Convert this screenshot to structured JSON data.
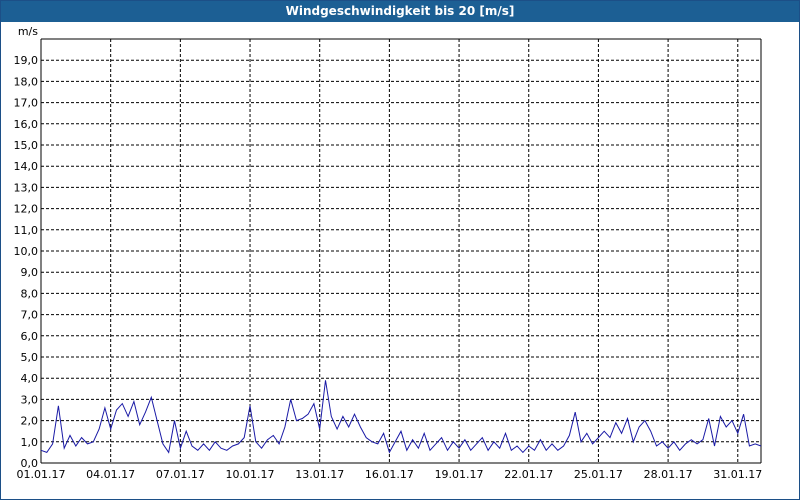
{
  "window": {
    "title": "Windgeschwindigkeit bis 20 [m/s]"
  },
  "colors": {
    "titlebar": "#1c5f94",
    "line": "#1a1aa6",
    "grid": "#000000"
  },
  "chart_data": {
    "type": "line",
    "title": "Windgeschwindigkeit bis 20 [m/s]",
    "ylabel": "m/s",
    "xlabel": "",
    "ylim": [
      0,
      20
    ],
    "xlim": [
      "2017-01-01",
      "2017-02-01"
    ],
    "grid": true,
    "y_ticks": [
      "0,0",
      "1,0",
      "2,0",
      "3,0",
      "4,0",
      "5,0",
      "6,0",
      "7,0",
      "8,0",
      "9,0",
      "10,0",
      "11,0",
      "12,0",
      "13,0",
      "14,0",
      "15,0",
      "16,0",
      "17,0",
      "18,0",
      "19,0"
    ],
    "x_ticks": [
      {
        "date": "2017-01-01",
        "label": "01.01.17"
      },
      {
        "date": "2017-01-04",
        "label": "04.01.17"
      },
      {
        "date": "2017-01-07",
        "label": "07.01.17"
      },
      {
        "date": "2017-01-10",
        "label": "10.01.17"
      },
      {
        "date": "2017-01-13",
        "label": "13.01.17"
      },
      {
        "date": "2017-01-16",
        "label": "16.01.17"
      },
      {
        "date": "2017-01-19",
        "label": "19.01.17"
      },
      {
        "date": "2017-01-22",
        "label": "22.01.17"
      },
      {
        "date": "2017-01-25",
        "label": "25.01.17"
      },
      {
        "date": "2017-01-28",
        "label": "28.01.17"
      },
      {
        "date": "2017-01-31",
        "label": "31.01.17"
      }
    ],
    "series": [
      {
        "values": [
          [
            "2017-01-01 00:00",
            0.6
          ],
          [
            "2017-01-01 06:00",
            0.5
          ],
          [
            "2017-01-01 12:00",
            0.9
          ],
          [
            "2017-01-01 18:00",
            2.7
          ],
          [
            "2017-01-02 00:00",
            0.7
          ],
          [
            "2017-01-02 06:00",
            1.3
          ],
          [
            "2017-01-02 12:00",
            0.8
          ],
          [
            "2017-01-02 18:00",
            1.2
          ],
          [
            "2017-01-03 00:00",
            0.9
          ],
          [
            "2017-01-03 06:00",
            1.0
          ],
          [
            "2017-01-03 12:00",
            1.6
          ],
          [
            "2017-01-03 18:00",
            2.6
          ],
          [
            "2017-01-04 00:00",
            1.6
          ],
          [
            "2017-01-04 06:00",
            2.5
          ],
          [
            "2017-01-04 12:00",
            2.8
          ],
          [
            "2017-01-04 18:00",
            2.2
          ],
          [
            "2017-01-05 00:00",
            2.9
          ],
          [
            "2017-01-05 06:00",
            1.8
          ],
          [
            "2017-01-05 12:00",
            2.4
          ],
          [
            "2017-01-05 18:00",
            3.1
          ],
          [
            "2017-01-06 00:00",
            2.0
          ],
          [
            "2017-01-06 06:00",
            0.9
          ],
          [
            "2017-01-06 12:00",
            0.5
          ],
          [
            "2017-01-06 18:00",
            2.0
          ],
          [
            "2017-01-07 00:00",
            0.7
          ],
          [
            "2017-01-07 06:00",
            1.5
          ],
          [
            "2017-01-07 12:00",
            0.8
          ],
          [
            "2017-01-07 18:00",
            0.6
          ],
          [
            "2017-01-08 00:00",
            0.9
          ],
          [
            "2017-01-08 06:00",
            0.6
          ],
          [
            "2017-01-08 12:00",
            1.0
          ],
          [
            "2017-01-08 18:00",
            0.7
          ],
          [
            "2017-01-09 00:00",
            0.6
          ],
          [
            "2017-01-09 06:00",
            0.8
          ],
          [
            "2017-01-09 12:00",
            0.9
          ],
          [
            "2017-01-09 18:00",
            1.2
          ],
          [
            "2017-01-10 00:00",
            2.7
          ],
          [
            "2017-01-10 06:00",
            1.0
          ],
          [
            "2017-01-10 12:00",
            0.7
          ],
          [
            "2017-01-10 18:00",
            1.1
          ],
          [
            "2017-01-11 00:00",
            1.3
          ],
          [
            "2017-01-11 06:00",
            0.9
          ],
          [
            "2017-01-11 12:00",
            1.7
          ],
          [
            "2017-01-11 18:00",
            3.0
          ],
          [
            "2017-01-12 00:00",
            2.0
          ],
          [
            "2017-01-12 06:00",
            2.1
          ],
          [
            "2017-01-12 12:00",
            2.3
          ],
          [
            "2017-01-12 18:00",
            2.8
          ],
          [
            "2017-01-13 00:00",
            1.6
          ],
          [
            "2017-01-13 06:00",
            3.9
          ],
          [
            "2017-01-13 12:00",
            2.2
          ],
          [
            "2017-01-13 18:00",
            1.6
          ],
          [
            "2017-01-14 00:00",
            2.2
          ],
          [
            "2017-01-14 06:00",
            1.7
          ],
          [
            "2017-01-14 12:00",
            2.3
          ],
          [
            "2017-01-14 18:00",
            1.7
          ],
          [
            "2017-01-15 00:00",
            1.2
          ],
          [
            "2017-01-15 06:00",
            1.0
          ],
          [
            "2017-01-15 12:00",
            0.9
          ],
          [
            "2017-01-15 18:00",
            1.4
          ],
          [
            "2017-01-16 00:00",
            0.5
          ],
          [
            "2017-01-16 06:00",
            1.0
          ],
          [
            "2017-01-16 12:00",
            1.5
          ],
          [
            "2017-01-16 18:00",
            0.6
          ],
          [
            "2017-01-17 00:00",
            1.1
          ],
          [
            "2017-01-17 06:00",
            0.7
          ],
          [
            "2017-01-17 12:00",
            1.4
          ],
          [
            "2017-01-17 18:00",
            0.6
          ],
          [
            "2017-01-18 00:00",
            0.9
          ],
          [
            "2017-01-18 06:00",
            1.2
          ],
          [
            "2017-01-18 12:00",
            0.6
          ],
          [
            "2017-01-18 18:00",
            1.0
          ],
          [
            "2017-01-19 00:00",
            0.7
          ],
          [
            "2017-01-19 06:00",
            1.1
          ],
          [
            "2017-01-19 12:00",
            0.6
          ],
          [
            "2017-01-19 18:00",
            0.9
          ],
          [
            "2017-01-20 00:00",
            1.2
          ],
          [
            "2017-01-20 06:00",
            0.6
          ],
          [
            "2017-01-20 12:00",
            1.0
          ],
          [
            "2017-01-20 18:00",
            0.7
          ],
          [
            "2017-01-21 00:00",
            1.4
          ],
          [
            "2017-01-21 06:00",
            0.6
          ],
          [
            "2017-01-21 12:00",
            0.8
          ],
          [
            "2017-01-21 18:00",
            0.5
          ],
          [
            "2017-01-22 00:00",
            0.8
          ],
          [
            "2017-01-22 06:00",
            0.6
          ],
          [
            "2017-01-22 12:00",
            1.1
          ],
          [
            "2017-01-22 18:00",
            0.6
          ],
          [
            "2017-01-23 00:00",
            0.9
          ],
          [
            "2017-01-23 06:00",
            0.6
          ],
          [
            "2017-01-23 12:00",
            0.8
          ],
          [
            "2017-01-23 18:00",
            1.3
          ],
          [
            "2017-01-24 00:00",
            2.4
          ],
          [
            "2017-01-24 06:00",
            1.0
          ],
          [
            "2017-01-24 12:00",
            1.4
          ],
          [
            "2017-01-24 18:00",
            0.9
          ],
          [
            "2017-01-25 00:00",
            1.2
          ],
          [
            "2017-01-25 06:00",
            1.5
          ],
          [
            "2017-01-25 12:00",
            1.2
          ],
          [
            "2017-01-25 18:00",
            1.9
          ],
          [
            "2017-01-26 00:00",
            1.4
          ],
          [
            "2017-01-26 06:00",
            2.1
          ],
          [
            "2017-01-26 12:00",
            1.0
          ],
          [
            "2017-01-26 18:00",
            1.7
          ],
          [
            "2017-01-27 00:00",
            2.0
          ],
          [
            "2017-01-27 06:00",
            1.5
          ],
          [
            "2017-01-27 12:00",
            0.8
          ],
          [
            "2017-01-27 18:00",
            1.0
          ],
          [
            "2017-01-28 00:00",
            0.7
          ],
          [
            "2017-01-28 06:00",
            1.0
          ],
          [
            "2017-01-28 12:00",
            0.6
          ],
          [
            "2017-01-28 18:00",
            0.9
          ],
          [
            "2017-01-29 00:00",
            1.1
          ],
          [
            "2017-01-29 06:00",
            0.9
          ],
          [
            "2017-01-29 12:00",
            1.1
          ],
          [
            "2017-01-29 18:00",
            2.1
          ],
          [
            "2017-01-30 00:00",
            0.8
          ],
          [
            "2017-01-30 06:00",
            2.2
          ],
          [
            "2017-01-30 12:00",
            1.7
          ],
          [
            "2017-01-30 18:00",
            2.0
          ],
          [
            "2017-01-31 00:00",
            1.4
          ],
          [
            "2017-01-31 06:00",
            2.3
          ],
          [
            "2017-01-31 12:00",
            0.8
          ],
          [
            "2017-01-31 18:00",
            0.9
          ],
          [
            "2017-02-01 00:00",
            0.8
          ]
        ]
      }
    ]
  }
}
